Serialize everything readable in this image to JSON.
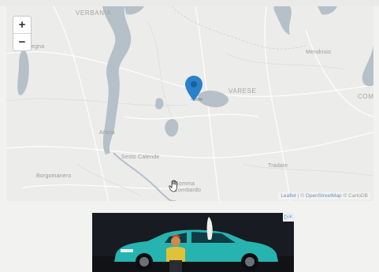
{
  "map": {
    "zoom_in_label": "+",
    "zoom_out_label": "−",
    "places": {
      "verbania": "VERBANIA",
      "varese": "VARESE",
      "como": "COMO",
      "mendrisio": "Mendrisio",
      "arona": "Arona",
      "sesto_calende": "Sesto Calende",
      "borgomanero": "Borgomanero",
      "tradate": "Tradate",
      "somma_lombardo": "Somma Lombardo",
      "vergiate": "egna"
    },
    "attribution": {
      "leaflet": "Leaflet",
      "separator": " | © ",
      "osm": "OpenStreetMap",
      "carto": " © CartoDB"
    },
    "colors": {
      "water": "#b5c0c9",
      "marker": "#2a81cb"
    }
  },
  "ad": {
    "badge": "▷×"
  }
}
